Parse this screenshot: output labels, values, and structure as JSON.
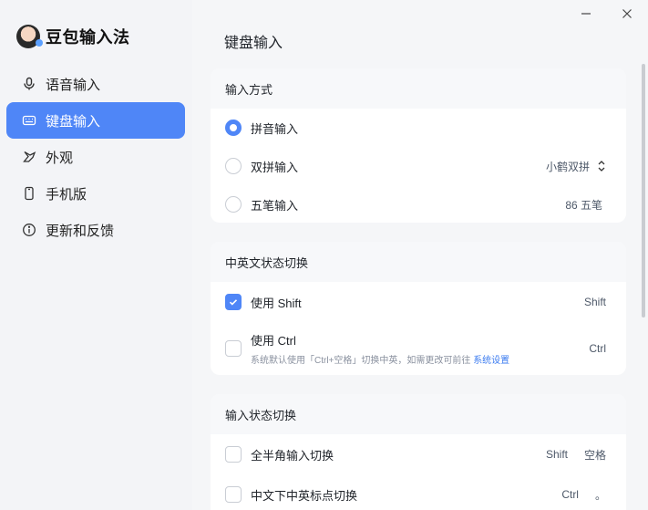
{
  "app": {
    "name": "豆包输入法"
  },
  "sidebar": {
    "items": [
      {
        "label": "语音输入",
        "icon": "microphone-icon",
        "active": false
      },
      {
        "label": "键盘输入",
        "icon": "keyboard-icon",
        "active": true
      },
      {
        "label": "外观",
        "icon": "appearance-icon",
        "active": false
      },
      {
        "label": "手机版",
        "icon": "phone-icon",
        "active": false
      },
      {
        "label": "更新和反馈",
        "icon": "info-icon",
        "active": false
      }
    ]
  },
  "window": {
    "minimize": "—",
    "close": "✕"
  },
  "main": {
    "title": "键盘输入",
    "input_method": {
      "header": "输入方式",
      "options": [
        {
          "label": "拼音输入",
          "selected": true,
          "value": ""
        },
        {
          "label": "双拼输入",
          "selected": false,
          "value": "小鹤双拼"
        },
        {
          "label": "五笔输入",
          "selected": false,
          "value": "86 五笔"
        }
      ]
    },
    "cn_en_switch": {
      "header": "中英文状态切换",
      "shift": {
        "label": "使用 Shift",
        "checked": true,
        "key": "Shift"
      },
      "ctrl": {
        "label": "使用 Ctrl",
        "checked": false,
        "key": "Ctrl",
        "sub": "系统默认使用「Ctrl+空格」切换中英，如需更改可前往",
        "link": "系统设置"
      }
    },
    "input_state_switch": {
      "header": "输入状态切换",
      "items": [
        {
          "label": "全半角输入切换",
          "checked": false,
          "key1": "Shift",
          "key2": "空格"
        },
        {
          "label": "中文下中英标点切换",
          "checked": false,
          "key1": "Ctrl",
          "key2": "。"
        }
      ]
    }
  },
  "colors": {
    "accent": "#4f86f7",
    "link": "#3c7cf0"
  }
}
